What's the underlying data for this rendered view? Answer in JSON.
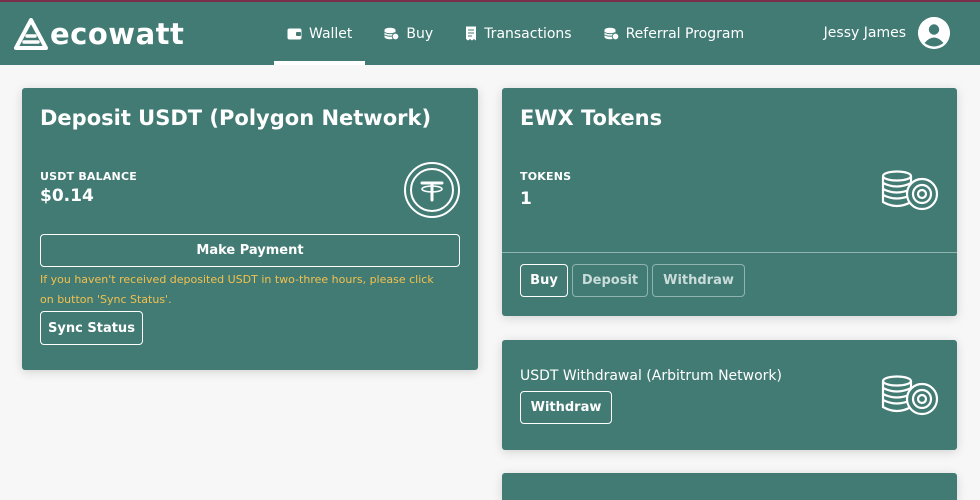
{
  "brand": {
    "name": "ecowatt"
  },
  "nav": {
    "items": [
      {
        "label": "Wallet",
        "icon": "wallet-icon",
        "active": true
      },
      {
        "label": "Buy",
        "icon": "coins-icon"
      },
      {
        "label": "Transactions",
        "icon": "receipt-icon"
      },
      {
        "label": "Referral Program",
        "icon": "coins-icon"
      }
    ]
  },
  "user": {
    "name": "Jessy James",
    "icon": "user-circle-icon"
  },
  "deposit": {
    "title": "Deposit USDT (Polygon Network)",
    "balance_label": "USDT BALANCE",
    "balance_value": "$0.14",
    "pay_label": "Make Payment",
    "note": "If you haven't received deposited USDT in two-three hours, please click on button 'Sync Status'.",
    "sync_label": "Sync Status",
    "icon": "tether-icon"
  },
  "tokens": {
    "title": "EWX Tokens",
    "tokens_label": "TOKENS",
    "tokens_value": "1",
    "buy_label": "Buy",
    "deposit_label": "Deposit",
    "withdraw_label": "Withdraw",
    "icon": "coins-stack-icon"
  },
  "withdrawal": {
    "title": "USDT Withdrawal (Arbitrum Network)",
    "withdraw_label": "Withdraw",
    "icon": "coins-stack-icon"
  },
  "colors": {
    "primary": "#427b74",
    "warning_text": "#f2c14e",
    "background": "#f7f7f7"
  }
}
